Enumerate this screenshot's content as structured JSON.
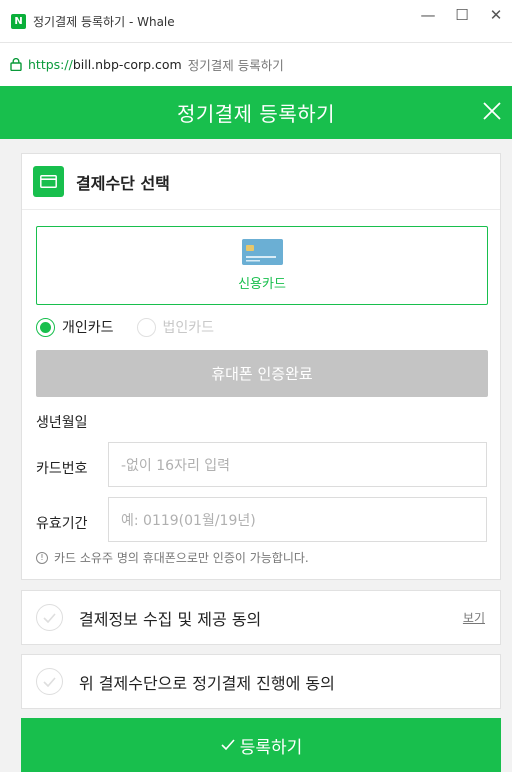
{
  "window": {
    "logo_letter": "N",
    "title": "정기결제 등록하기 - Whale",
    "minimize_glyph": "—",
    "maximize_glyph": "☐",
    "close_glyph": "✕"
  },
  "address": {
    "scheme": "https://",
    "domain": "bill.nbp-corp.com",
    "page_title": "정기결제 등록하기"
  },
  "header": {
    "title": "정기결제 등록하기"
  },
  "payment": {
    "section_title": "결제수단 선택",
    "card_option_label": "신용카드",
    "radios": [
      {
        "label": "개인카드",
        "selected": true
      },
      {
        "label": "법인카드",
        "selected": false
      }
    ],
    "auth_button": "휴대폰 인증완료",
    "fields": {
      "birth_label": "생년월일",
      "card_label": "카드번호",
      "card_placeholder": "-없이 16자리 입력",
      "expiry_label": "유효기간",
      "expiry_placeholder": "예: 0119(01월/19년)"
    },
    "notice": "카드 소유주 명의 휴대폰으로만 인증이 가능합니다.",
    "notice_icon": "!"
  },
  "agreements": [
    {
      "label": "결제정보 수집 및 제공 동의",
      "link": "보기"
    },
    {
      "label": "위 결제수단으로 정기결제 진행에 동의"
    }
  ],
  "submit": {
    "label": "등록하기"
  },
  "colors": {
    "accent": "#18bf4d",
    "disabled": "#c4c4c4"
  }
}
